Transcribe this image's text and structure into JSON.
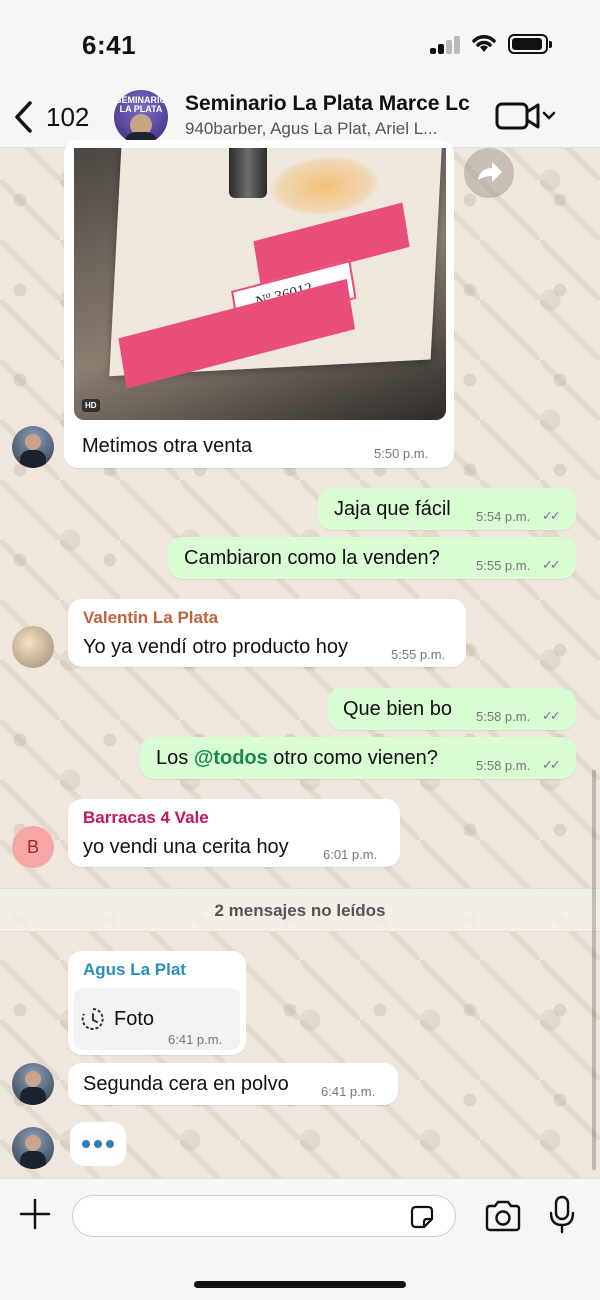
{
  "status_bar": {
    "time": "6:41"
  },
  "header": {
    "back_count": "102",
    "avatar_text": "SEMINARIO LA PLATA",
    "title": "Seminario La Plata Marce Lc",
    "subtitle": "940barber, Agus La Plat, Ariel L..."
  },
  "messages": [
    {
      "text": "Metimos otra venta",
      "time": "5:50 p.m.",
      "image_badge": "HD",
      "certificate_number": "Nº 36012"
    },
    {
      "text": "Jaja que fácil",
      "time": "5:54 p.m."
    },
    {
      "text": "Cambiaron como la venden?",
      "time": "5:55 p.m."
    },
    {
      "sender": "Valentin La Plata",
      "text": "Yo ya vendí otro producto hoy",
      "time": "5:55 p.m.",
      "sender_color": "#c0633a"
    },
    {
      "text": "Que bien bo",
      "time": "5:58 p.m."
    },
    {
      "text_before": "Los ",
      "mention": "@todos",
      "text_after": " otro como vienen?",
      "time": "5:58 p.m."
    },
    {
      "sender": "Barracas 4 Vale",
      "avatar_letter": "B",
      "text": "yo vendi una cerita hoy",
      "time": "6:01 p.m.",
      "sender_color": "#c2185b"
    },
    {
      "sender": "Agus La Plat",
      "text": "Foto",
      "time": "6:41 p.m.",
      "sender_color": "#2a8fbd"
    },
    {
      "text": "Segunda cera en polvo",
      "time": "6:41 p.m."
    }
  ],
  "unread_divider": "2 mensajes no leídos",
  "composer": {
    "placeholder": ""
  },
  "colors": {
    "outgoing": "#d9fdd3",
    "incoming": "#ffffff",
    "ticks": "#6b7b8a",
    "mention": "#1f8a4c"
  }
}
